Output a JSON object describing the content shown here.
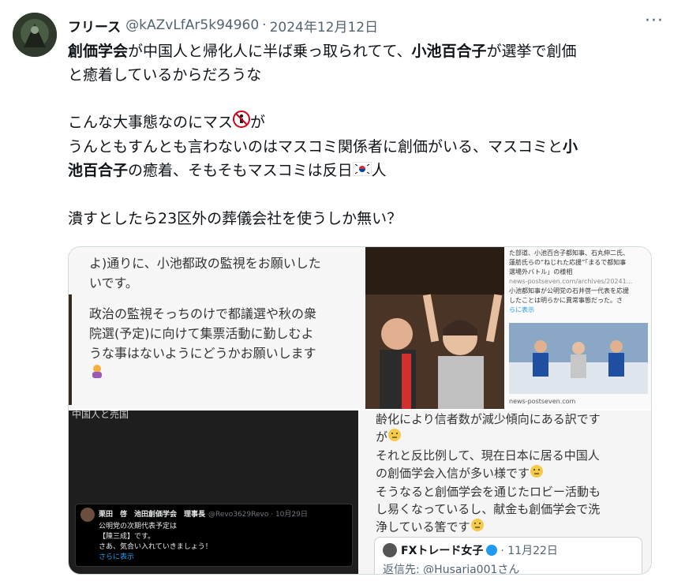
{
  "post": {
    "display_name": "フリース",
    "handle": "@kAZvLfAr5k94960",
    "separator": "·",
    "date": "2024年12月12日",
    "more_label": "···",
    "lines": [
      [
        "創価学会",
        "が中国人と帰化人に半ば乗っ取られてて、",
        "小池百合子",
        "が選挙で創価"
      ],
      "と癒着しているからだろうな",
      "こんな大事態なのにマス",
      "が",
      "うんともすんとも言わないのはマスコミ関係者に創価がいる、マスコミと",
      "小",
      "池百合子",
      "の癒着、そもそもマスコミは反日",
      "人",
      "潰すとしたら23区外の葬儀会社を使うしか無い？"
    ]
  },
  "media": {
    "img1": {
      "lines": [
        "よ)通りに、小池都政の監視をお願いした",
        "いです。",
        "政治の監視そっちのけで都議選や秋の衆",
        "院選(予定)に向けて集票活動に勤しむよ",
        "うな事はないようにどうかお願いします"
      ]
    },
    "img2": {
      "web_lines": [
        "た部道、小池百合子都知事、石丸伸二氏、",
        "蓮舫氏らの“ねじれた応援”「まるで都知事",
        "選場外バトル」の様相",
        "news-postseven.com/archives/20241...",
        "小池都知事が公明党の石井啓一代表を応援",
        "したことは明らかに異常事態だった。さ",
        "らに表示",
        "news-postseven.com"
      ]
    },
    "img3": {
      "header_text": "中国人と売国",
      "tweet_name": "栗田　啓　池田創価学会　理事長",
      "tweet_handle": "@Revo3629Revo · 10月29日",
      "tweet_lines": [
        "公明党の次期代表予定は",
        "【陳三成】です。",
        "さあ、気合い入れていきましょう！",
        "さらに表示"
      ]
    },
    "img4": {
      "lines": [
        "齢化により信者数が減少傾向にある訳です",
        "が",
        "それと反比例して、現在日本に居る中国人",
        "の創価学会入信が多い様です",
        "そうなると創価学会を通じたロビー活動も",
        "し易くなっているし、献金も創価学会で洗",
        "浄している筈です"
      ],
      "card_name": "FXトレード女子",
      "card_date": "· 11月22日",
      "card_reply": "返信先: @Husaria001さん"
    }
  },
  "colors": {
    "text": "#0f1419",
    "secondary": "#536471",
    "border": "#cfd9de"
  }
}
